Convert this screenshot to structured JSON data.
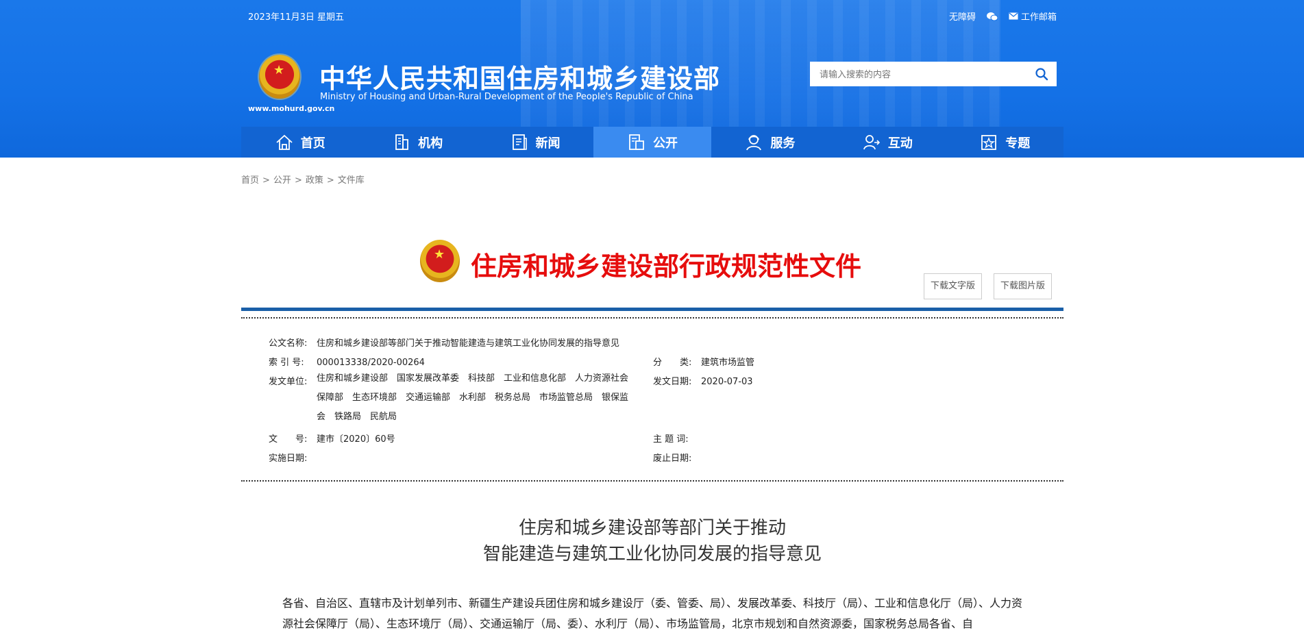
{
  "header": {
    "date": "2023年11月3日 星期五",
    "links": [
      {
        "label": "无障碍",
        "icon": "accessibility"
      },
      {
        "label": "",
        "icon": "wechat-icon"
      },
      {
        "label": "工作邮箱",
        "icon": "mail-icon"
      }
    ],
    "site_title": "中华人民共和国住房和城乡建设部",
    "site_subtitle": "Ministry of Housing and Urban-Rural Development of the People's Republic of China",
    "url": "www.mohurd.gov.cn",
    "search_placeholder": "请输入搜索的内容"
  },
  "nav": {
    "items": [
      {
        "label": "首页",
        "icon": "home-icon"
      },
      {
        "label": "机构",
        "icon": "building-icon"
      },
      {
        "label": "新闻",
        "icon": "news-icon"
      },
      {
        "label": "公开",
        "icon": "document-icon",
        "active": true
      },
      {
        "label": "服务",
        "icon": "service-icon"
      },
      {
        "label": "互动",
        "icon": "interaction-icon"
      },
      {
        "label": "专题",
        "icon": "star-icon"
      }
    ],
    "active_color": "#3a8bf0",
    "bar_color": "#1264d2"
  },
  "breadcrumb": [
    "首页",
    "公开",
    "政策",
    "文件库"
  ],
  "doc_header": {
    "title": "住房和城乡建设部行政规范性文件",
    "download_text": "下载文字版",
    "download_image": "下载图片版"
  },
  "meta": {
    "doc_name_label": "公文名称:",
    "doc_name": "住房和城乡建设部等部门关于推动智能建造与建筑工业化协同发展的指导意见",
    "index_label": "索 引 号:",
    "index": "000013338/2020-00264",
    "category_label": "分　　类:",
    "category": "建筑市场监管",
    "issuer_label": "发文单位:",
    "issuers": "住房和城乡建设部　国家发展改革委　科技部　工业和信息化部　人力资源社会保障部　生态环境部　交通运输部　水利部　税务总局　市场监管总局　银保监会　铁路局　民航局",
    "issue_date_label": "发文日期:",
    "issue_date": "2020-07-03",
    "doc_no_label": "文　　号:",
    "doc_no": "建市〔2020〕60号",
    "keywords_label": "主 题 词:",
    "keywords": "",
    "effective_label": "实施日期:",
    "effective": "",
    "repeal_label": "废止日期:",
    "repeal": ""
  },
  "article": {
    "title_line1": "住房和城乡建设部等部门关于推动",
    "title_line2": "智能建造与建筑工业化协同发展的指导意见",
    "body": "各省、自治区、直辖市及计划单列市、新疆生产建设兵团住房和城乡建设厅（委、管委、局）、发展改革委、科技厅（局）、工业和信息化厅（局）、人力资源社会保障厅（局）、生态环境厅（局）、交通运输厅（局、委）、水利厅（局）、市场监管局，北京市规划和自然资源委，国家税务总局各省、自"
  }
}
